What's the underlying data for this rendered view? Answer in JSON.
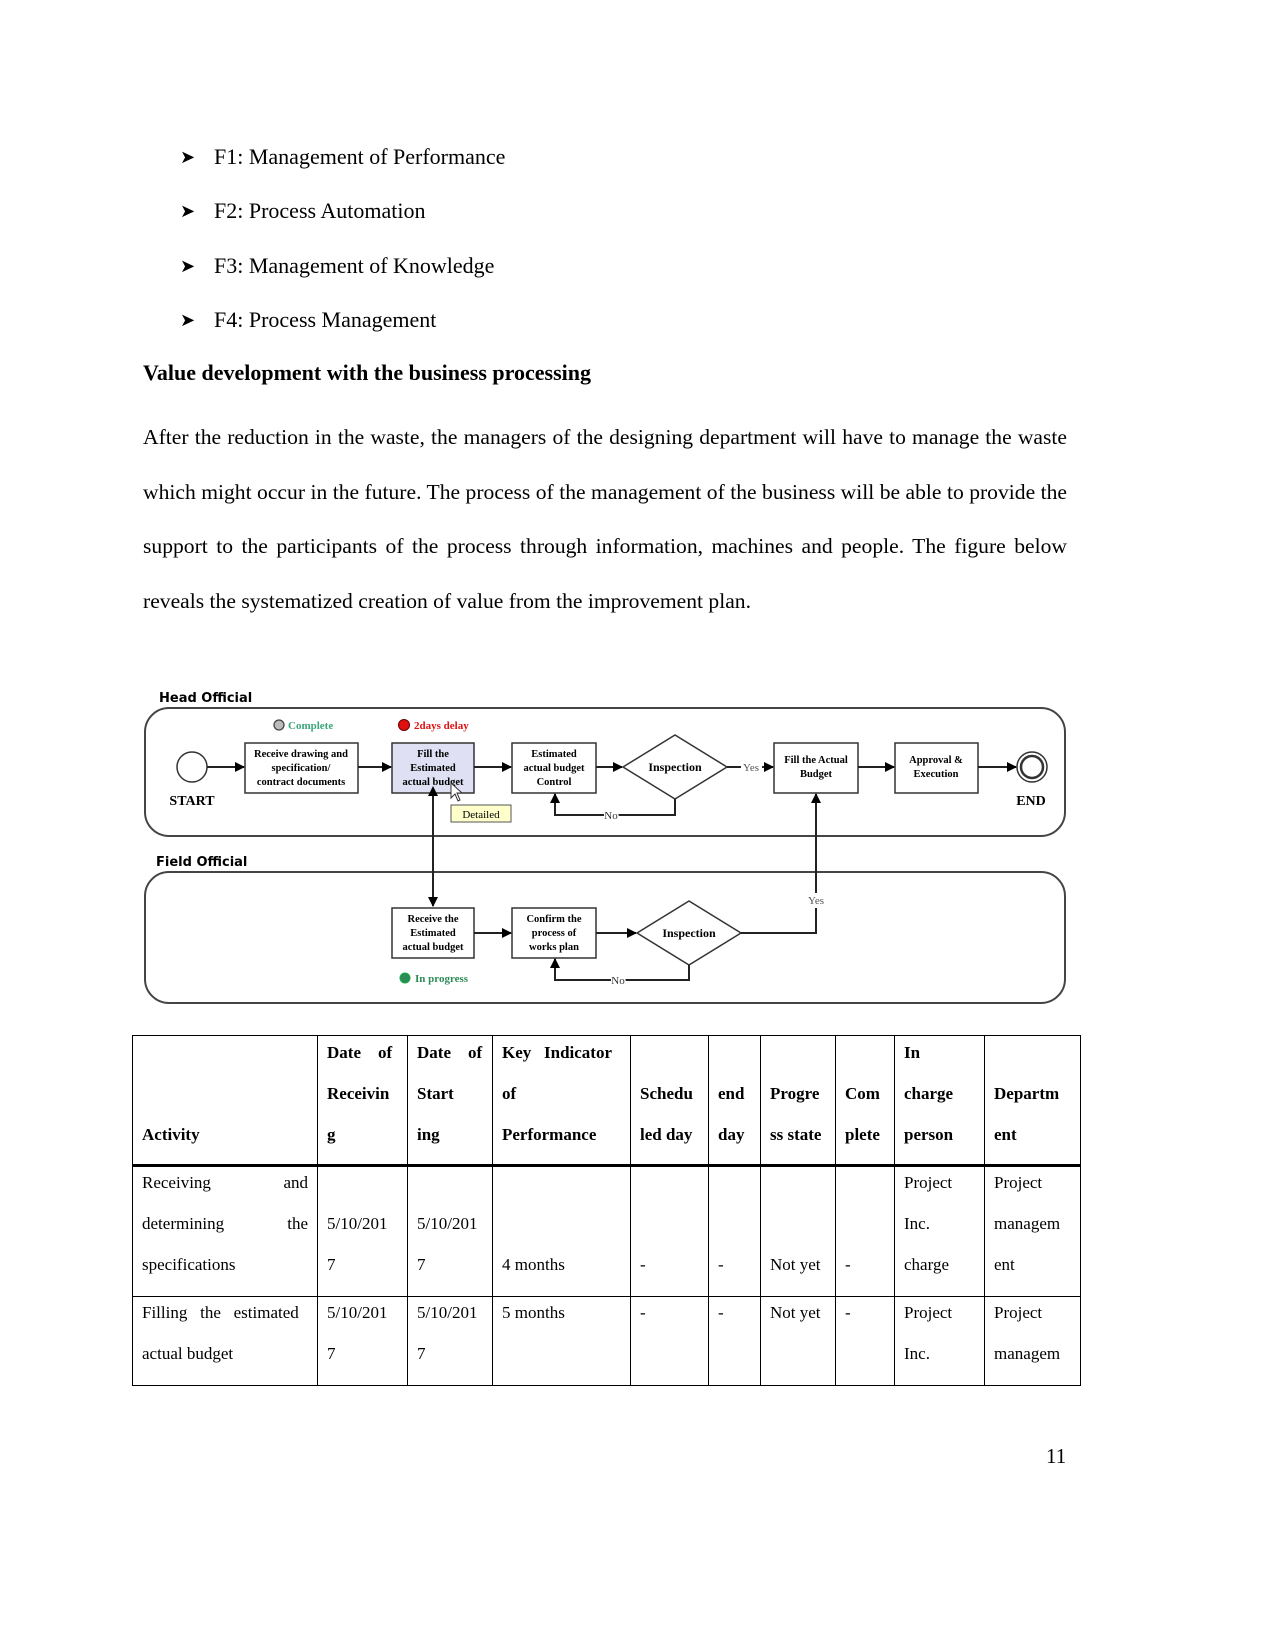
{
  "bullets": [
    "F1: Management of Performance",
    "F2: Process Automation",
    "F3: Management of Knowledge",
    "F4: Process Management"
  ],
  "bullet_icon": "arrowhead-bullet-icon",
  "heading": "Value development with the business processing",
  "paragraph": "After the reduction in the waste, the managers of the designing department will have to manage the waste which might occur in the future. The process of the management of the business will be able to provide the support to the participants of the process through information, machines and people. The figure below reveals the systematized creation of value from the improvement plan.",
  "diagram": {
    "lane_head": "Head Official",
    "lane_field": "Field Official",
    "start": "START",
    "end": "END",
    "status_complete": "Complete",
    "status_delay": "2days delay",
    "status_progress": "In progress",
    "tooltip": "Detailed",
    "box_receive_drawing": [
      "Receive drawing and",
      "specification/",
      "contract documents"
    ],
    "box_fill_estimated": [
      "Fill the",
      "Estimated",
      "actual budget"
    ],
    "box_estimated_control": [
      "Estimated",
      "actual budget",
      "Control"
    ],
    "inspection_1": "Inspection",
    "box_fill_actual": [
      "Fill the Actual",
      "Budget"
    ],
    "box_approval": [
      "Approval &",
      "Execution"
    ],
    "box_receive_estimated": [
      "Receive the",
      "Estimated",
      "actual budget"
    ],
    "box_confirm": [
      "Confirm the",
      "process of",
      "works plan"
    ],
    "inspection_2": "Inspection",
    "yes_1": "Yes",
    "yes_2": "Yes",
    "no_1": "No",
    "no_2": "No",
    "colors": {
      "complete": "#3aa57a",
      "delay": "#e01010",
      "progress": "#2e8b57",
      "highlight": "#e0e0f5",
      "tooltip": "#ffffcc"
    }
  },
  "table": {
    "headers": [
      [
        "Activity"
      ],
      [
        "Date    of",
        "Receivin",
        "g"
      ],
      [
        "Date    of",
        "Start",
        "ing"
      ],
      [
        "Key   Indicator",
        "of",
        "Performance"
      ],
      [
        "Schedu",
        "led day"
      ],
      [
        "end",
        "day"
      ],
      [
        "Progre",
        "ss state"
      ],
      [
        "Com",
        "plete"
      ],
      [
        "In",
        "charge",
        "person"
      ],
      [
        "Departm",
        "ent"
      ]
    ],
    "rows": [
      [
        [
          "Receiving|and",
          "determining|the",
          "specifications"
        ],
        [
          "",
          "5/10/201",
          "7"
        ],
        [
          "",
          "5/10/201",
          "7"
        ],
        [
          "",
          "",
          "4 months"
        ],
        [
          "",
          "",
          "-"
        ],
        [
          "",
          "",
          "-"
        ],
        [
          "",
          "",
          "Not yet"
        ],
        [
          "",
          "",
          "-"
        ],
        [
          "Project",
          "Inc.",
          "charge"
        ],
        [
          "Project",
          "managem",
          "ent"
        ]
      ],
      [
        [
          "Filling   the   estimated",
          "actual budget"
        ],
        [
          "5/10/201",
          "7"
        ],
        [
          "5/10/201",
          "7"
        ],
        [
          "5 months"
        ],
        [
          "-"
        ],
        [
          "-"
        ],
        [
          "Not yet"
        ],
        [
          "-"
        ],
        [
          "Project",
          "Inc."
        ],
        [
          "Project",
          "managem"
        ]
      ]
    ]
  },
  "page_number": "11"
}
